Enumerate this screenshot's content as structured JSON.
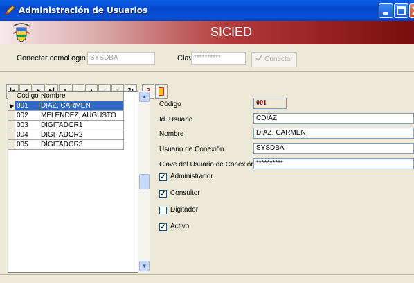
{
  "window": {
    "title": "Administración de Usuarios"
  },
  "banner": {
    "brand": "SICIED"
  },
  "login": {
    "label_connect": "Conectar como",
    "label_login": "Login",
    "login_value": "SYSDBA",
    "label_password": "Clave",
    "password_value": "**********",
    "connect_button": "Conectar"
  },
  "navigator": {
    "buttons": [
      "first",
      "prior",
      "next",
      "last",
      "insert",
      "delete",
      "edit",
      "post",
      "cancel",
      "refresh"
    ]
  },
  "grid": {
    "headers": [
      "Código",
      "Nombre"
    ],
    "rows": [
      {
        "code": "001",
        "name": "DIAZ, CARMEN",
        "selected": true
      },
      {
        "code": "002",
        "name": "MELENDEZ, AUGUSTO"
      },
      {
        "code": "003",
        "name": "DIGITADOR1"
      },
      {
        "code": "004",
        "name": "DIGITADOR2"
      },
      {
        "code": "005",
        "name": "DIGITADOR3"
      }
    ]
  },
  "detail": {
    "codigo_label": "Código",
    "codigo_value": "001",
    "id_label": "Id. Usuario",
    "id_value": "CDIAZ",
    "nombre_label": "Nombre",
    "nombre_value": "DIAZ, CARMEN",
    "conexion_label": "Usuario de Conexión",
    "conexion_value": "SYSDBA",
    "clave_label": "Clave del Usuario de Conexión",
    "clave_value": "**********",
    "checks": [
      {
        "label": "Administrador",
        "checked": true
      },
      {
        "label": "Consultor",
        "checked": true
      },
      {
        "label": "Digitador",
        "checked": false
      },
      {
        "label": "Activo",
        "checked": true
      }
    ]
  },
  "colors": {
    "accent": "#316ac5",
    "banner": "#8b1a1a",
    "code_text": "#6b0000"
  }
}
